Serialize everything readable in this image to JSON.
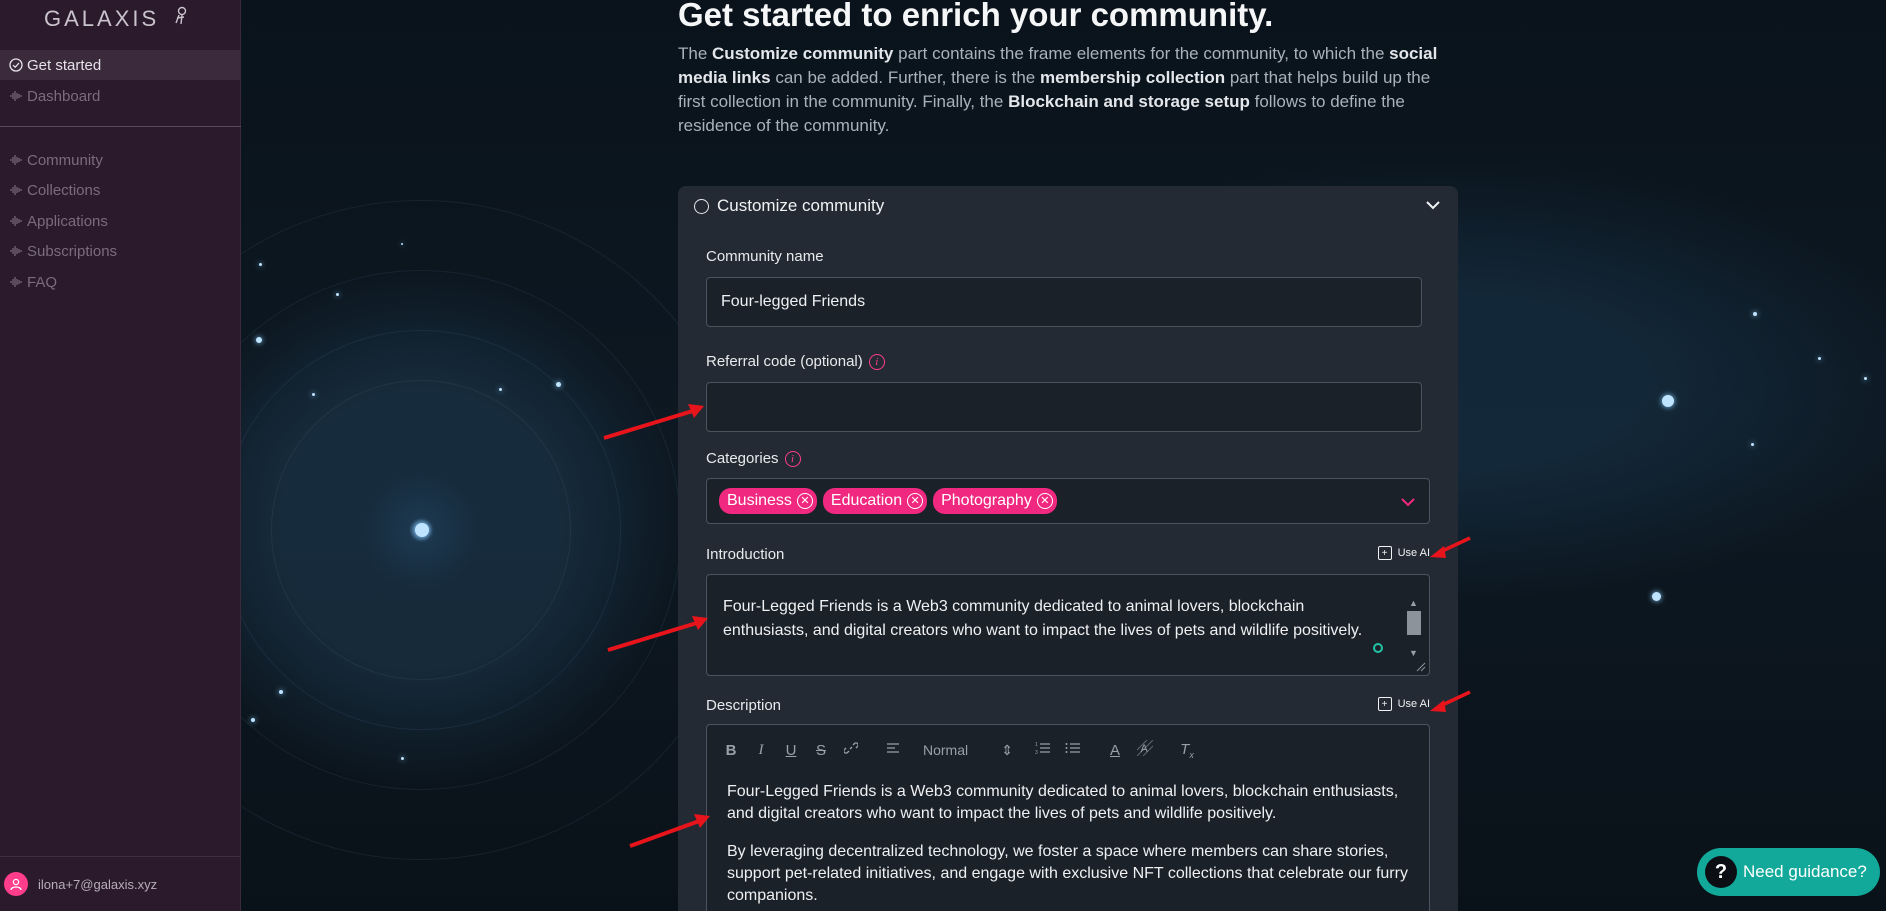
{
  "brand": {
    "logo_text": "GALAXIS"
  },
  "sidebar": {
    "items": [
      {
        "label": "Get started",
        "icon": "check-circle-icon",
        "active": true
      },
      {
        "label": "Dashboard",
        "icon": "waveform-icon"
      },
      {
        "label": "Community",
        "icon": "waveform-icon"
      },
      {
        "label": "Collections",
        "icon": "waveform-icon"
      },
      {
        "label": "Applications",
        "icon": "waveform-icon"
      },
      {
        "label": "Subscriptions",
        "icon": "waveform-icon"
      },
      {
        "label": "FAQ",
        "icon": "waveform-icon"
      }
    ],
    "user_email": "ilona+7@galaxis.xyz"
  },
  "page": {
    "title": "Get started to enrich your community.",
    "intro": {
      "p1": "The ",
      "b1": "Customize community",
      "p2": " part contains the frame elements for the community, to which the ",
      "b2": "social media links",
      "p3": " can be added. Further, there is the ",
      "b3": "membership collection",
      "p4": " part that helps build up the first collection in the community. Finally, the ",
      "b4": "Blockchain and storage setup",
      "p5": " follows to define the residence of the community."
    }
  },
  "panel": {
    "title": "Customize community",
    "community_name": {
      "label": "Community name",
      "value": "Four-legged Friends"
    },
    "referral": {
      "label": "Referral code (optional)",
      "value": ""
    },
    "categories": {
      "label": "Categories",
      "chips": [
        "Business",
        "Education",
        "Photography"
      ]
    },
    "introduction": {
      "label": "Introduction",
      "use_ai": "Use AI",
      "value": "Four-Legged Friends is a Web3 community dedicated to animal lovers, blockchain enthusiasts, and digital creators who want to impact the lives of pets and wildlife positively."
    },
    "description": {
      "label": "Description",
      "use_ai": "Use AI",
      "toolbar": {
        "format": "Normal"
      },
      "paragraphs": [
        "Four-Legged Friends is a Web3 community dedicated to animal lovers, blockchain enthusiasts, and digital creators who want to impact the lives of pets and wildlife positively.",
        "By leveraging decentralized technology, we foster a space where members can share stories, support pet-related initiatives, and engage with exclusive NFT collections that celebrate our furry companions."
      ]
    }
  },
  "guidance": {
    "label": "Need guidance?"
  },
  "colors": {
    "accent": "#f0287f",
    "teal": "#12a99a",
    "sidebar": "#2a1a2c",
    "panel": "#232a33",
    "annotation": "#e8141b"
  }
}
